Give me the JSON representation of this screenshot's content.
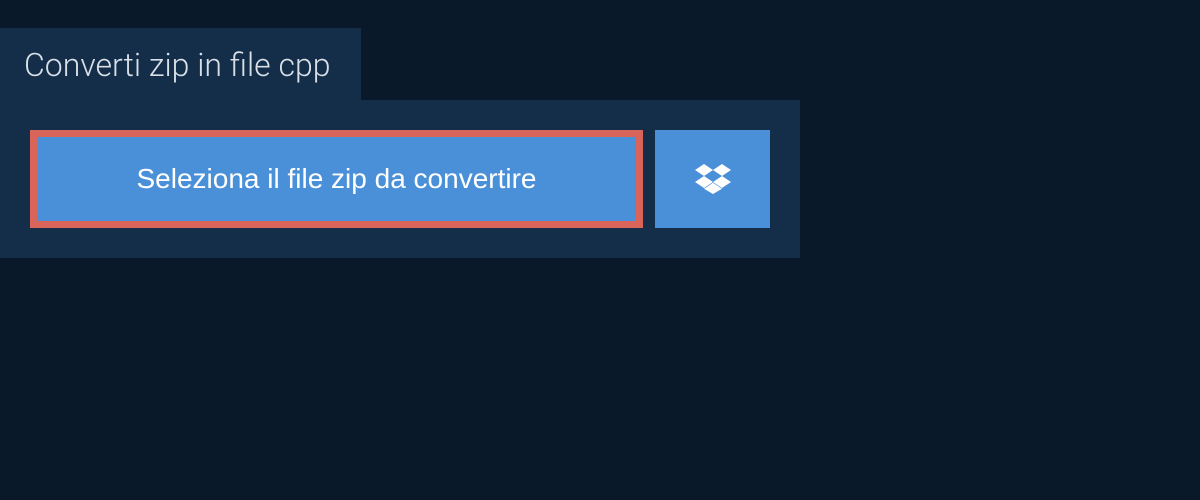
{
  "header": {
    "title": "Converti zip in file cpp"
  },
  "actions": {
    "select_file_label": "Seleziona il file zip da convertire",
    "dropbox_icon_name": "dropbox-icon"
  },
  "colors": {
    "background": "#0a1929",
    "panel": "#142e4a",
    "button": "#4a90d9",
    "highlight_border": "#d96459",
    "text_light": "#ffffff",
    "text_header": "#d8dfe6"
  }
}
